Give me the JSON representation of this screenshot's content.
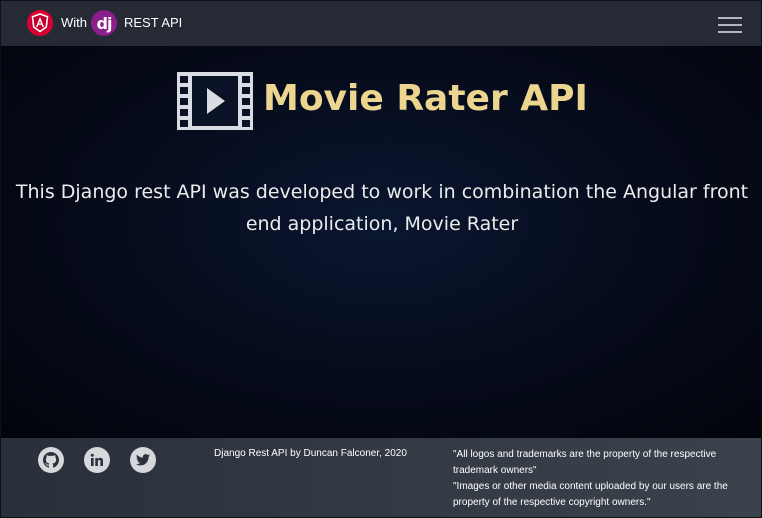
{
  "navbar": {
    "with_label": "With",
    "django_logo_text": "dj",
    "rest_label": "REST API",
    "icons": [
      "angular-logo-icon",
      "django-logo-icon",
      "hamburger-menu-icon"
    ]
  },
  "hero": {
    "title": "Movie Rater API",
    "description": "This Django rest API was developed to work in combination the Angular front end application, Movie Rater",
    "icon": "film-strip-icon",
    "title_color": "#ecd58f"
  },
  "footer": {
    "social": [
      {
        "name": "github-icon"
      },
      {
        "name": "linkedin-icon"
      },
      {
        "name": "twitter-icon"
      }
    ],
    "credit": "Django Rest API by Duncan Falconer, 2020",
    "notes": [
      "\"All logos and trademarks are the property of the respective trademark owners\"",
      "\"Images or other media content uploaded by our users are the property of the respective copyright owners.\""
    ]
  },
  "colors": {
    "navbar_bg": "#252a35",
    "angular_red": "#dd0031",
    "django_purple": "#8a1f8a",
    "hero_bg": "#060b1a",
    "footer_bg": "#343b45"
  }
}
